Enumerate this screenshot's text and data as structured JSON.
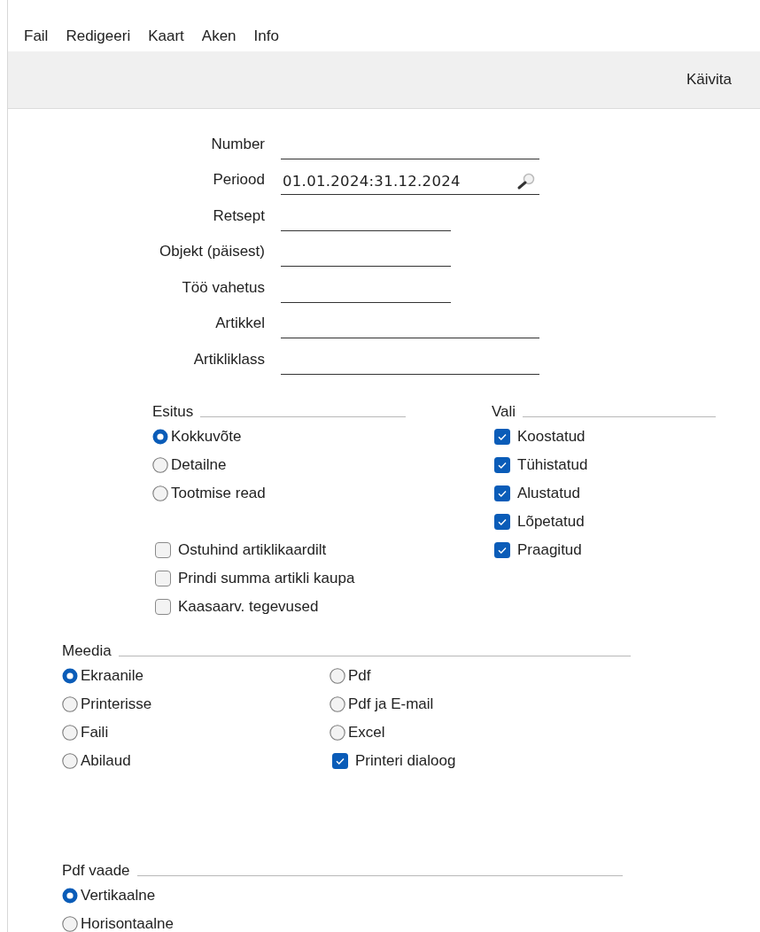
{
  "menu": [
    {
      "label": "Fail"
    },
    {
      "label": "Redigeeri"
    },
    {
      "label": "Kaart"
    },
    {
      "label": "Aken"
    },
    {
      "label": "Info"
    }
  ],
  "toolbar": {
    "run_button": "Käivita"
  },
  "fields": [
    {
      "label": "Number",
      "kind": "long",
      "lookup": false
    },
    {
      "label": "Periood",
      "kind": "long",
      "value": "01.01.2024:31.12.2024",
      "lookup": true
    },
    {
      "label": "Retsept",
      "kind": "short",
      "lookup": false
    },
    {
      "label": "Objekt (päisest)",
      "kind": "short",
      "lookup": false
    },
    {
      "label": "Töö vahetus",
      "kind": "short",
      "lookup": false
    },
    {
      "label": "Artikkel",
      "kind": "long",
      "lookup": false
    },
    {
      "label": "Artikliklass",
      "kind": "long",
      "lookup": false
    }
  ],
  "esitus": {
    "title": "Esitus",
    "items": [
      {
        "kind": "radio",
        "label": "Kokkuvõte",
        "selected": true
      },
      {
        "kind": "radio",
        "label": "Detailne",
        "selected": false
      },
      {
        "kind": "radio",
        "label": "Tootmise read",
        "selected": false
      },
      {
        "kind": "spacer"
      },
      {
        "kind": "checkbox",
        "label": "Ostuhind artiklikaardilt",
        "checked": false
      },
      {
        "kind": "checkbox",
        "label": "Prindi summa artikli kaupa",
        "checked": false
      },
      {
        "kind": "checkbox",
        "label": "Kaasaarv. tegevused",
        "checked": false
      }
    ]
  },
  "vali": {
    "title": "Vali",
    "items": [
      {
        "kind": "checkbox",
        "label": "Koostatud",
        "checked": true
      },
      {
        "kind": "checkbox",
        "label": "Tühistatud",
        "checked": true
      },
      {
        "kind": "checkbox",
        "label": "Alustatud",
        "checked": true
      },
      {
        "kind": "checkbox",
        "label": "Lõpetatud",
        "checked": true
      },
      {
        "kind": "checkbox",
        "label": "Praagitud",
        "checked": true
      }
    ]
  },
  "meedia": {
    "title": "Meedia",
    "items": [
      {
        "kind": "radio",
        "label": "Ekraanile",
        "selected": true
      },
      {
        "kind": "radio",
        "label": "Printerisse",
        "selected": false
      },
      {
        "kind": "radio",
        "label": "Faili",
        "selected": false
      },
      {
        "kind": "radio",
        "label": "Abilaud",
        "selected": false
      },
      {
        "kind": "radio",
        "label": "Pdf",
        "selected": false
      },
      {
        "kind": "radio",
        "label": "Pdf ja E-mail",
        "selected": false
      },
      {
        "kind": "radio",
        "label": "Excel",
        "selected": false
      },
      {
        "kind": "checkbox",
        "label": "Printeri dialoog",
        "checked": true
      }
    ]
  },
  "pdf_vaade": {
    "title": "Pdf vaade",
    "items": [
      {
        "kind": "radio",
        "label": "Vertikaalne",
        "selected": true
      },
      {
        "kind": "radio",
        "label": "Horisontaalne",
        "selected": false
      }
    ]
  }
}
